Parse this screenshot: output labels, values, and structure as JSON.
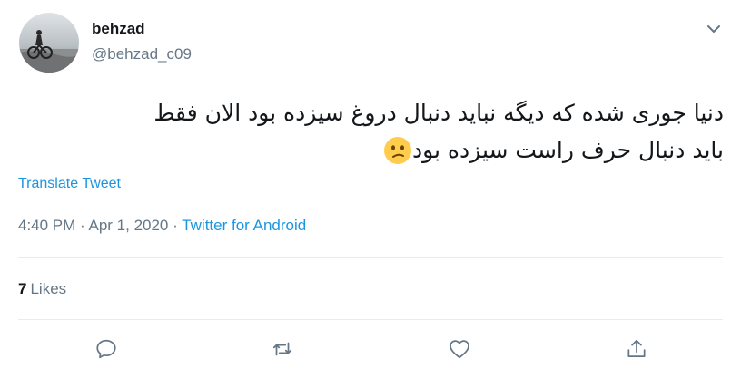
{
  "user": {
    "display_name": "behzad",
    "handle": "@behzad_c09",
    "avatar_icon": "avatar-photo"
  },
  "tweet": {
    "text_line_1": "دنیا جوری شده که دیگه نباید دنبال دروغ سیزده بود الان فقط",
    "text_line_2": "باید دنبال حرف راست سیزده بود",
    "emoji": "confused-face-emoji"
  },
  "translate_label": "Translate Tweet",
  "meta": {
    "time": "4:40 PM",
    "separator": " · ",
    "date": "Apr 1, 2020",
    "source": "Twitter for Android"
  },
  "stats": {
    "likes_count": "7",
    "likes_label": "Likes"
  },
  "actions": {
    "reply_icon": "reply-icon",
    "retweet_icon": "retweet-icon",
    "like_icon": "like-icon",
    "share_icon": "share-icon"
  },
  "colors": {
    "link": "#1b95e0",
    "secondary": "#657786",
    "primary": "#14171a",
    "divider": "#e6ecf0"
  }
}
